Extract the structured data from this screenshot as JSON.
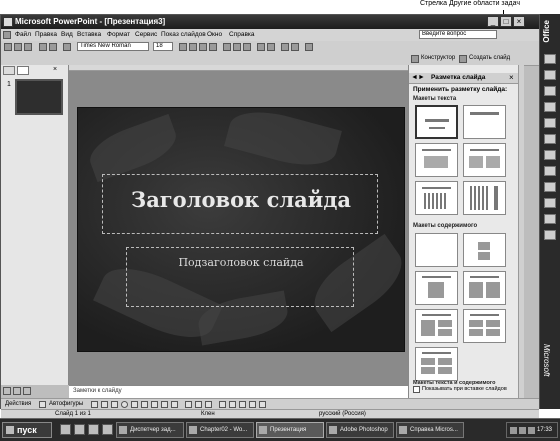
{
  "callout": {
    "text": "Стрелка Другие области задач"
  },
  "window": {
    "title": "Microsoft PowerPoint - [Презентация3]",
    "controls": {
      "minimize": "_",
      "maximize": "□",
      "close": "×"
    }
  },
  "menu": {
    "items": [
      "Файл",
      "Правка",
      "Вид",
      "Вставка",
      "Формат",
      "Сервис",
      "Показ слайдов",
      "Окно",
      "Справка"
    ],
    "help_placeholder": "Введите вопрос"
  },
  "toolbar1": {
    "font_name": "Times New Roman",
    "font_size": "18"
  },
  "toolbar2": {
    "design_label": "Конструктор",
    "new_slide_label": "Создать слайд"
  },
  "slides_panel": {
    "slide_number": "1"
  },
  "slide": {
    "title": "Заголовок слайда",
    "subtitle": "Подзаголовок слайда"
  },
  "notes": {
    "placeholder": "Заметки к слайду"
  },
  "draw_toolbar": {
    "actions_label": "Действия",
    "autoshapes_label": "Автофигуры"
  },
  "status": {
    "slide_info": "Слайд 1 из 1",
    "design": "Клен",
    "language": "русский (Россия)"
  },
  "task_pane": {
    "title": "Разметка слайда",
    "apply_label": "Применить разметку слайда:",
    "section_text": "Макеты текста",
    "section_content": "Макеты содержимого",
    "section_text_content": "Макеты текста и содержимого",
    "footer_label": "Показывать при вставке слайдов"
  },
  "office_bar": {
    "label": "Office",
    "vendor": "Microsoft"
  },
  "taskbar": {
    "start_label": "пуск",
    "items": [
      "Диспетчер зад...",
      "Chapter02 - Wo...",
      "Презентация",
      "Adobe Photoshop",
      "Справка Micros..."
    ],
    "clock": "17:33"
  },
  "colors": {
    "slide_bg": "#262626",
    "window_chrome": "#bdbdbd",
    "taskbar": "#2a2a2a"
  }
}
